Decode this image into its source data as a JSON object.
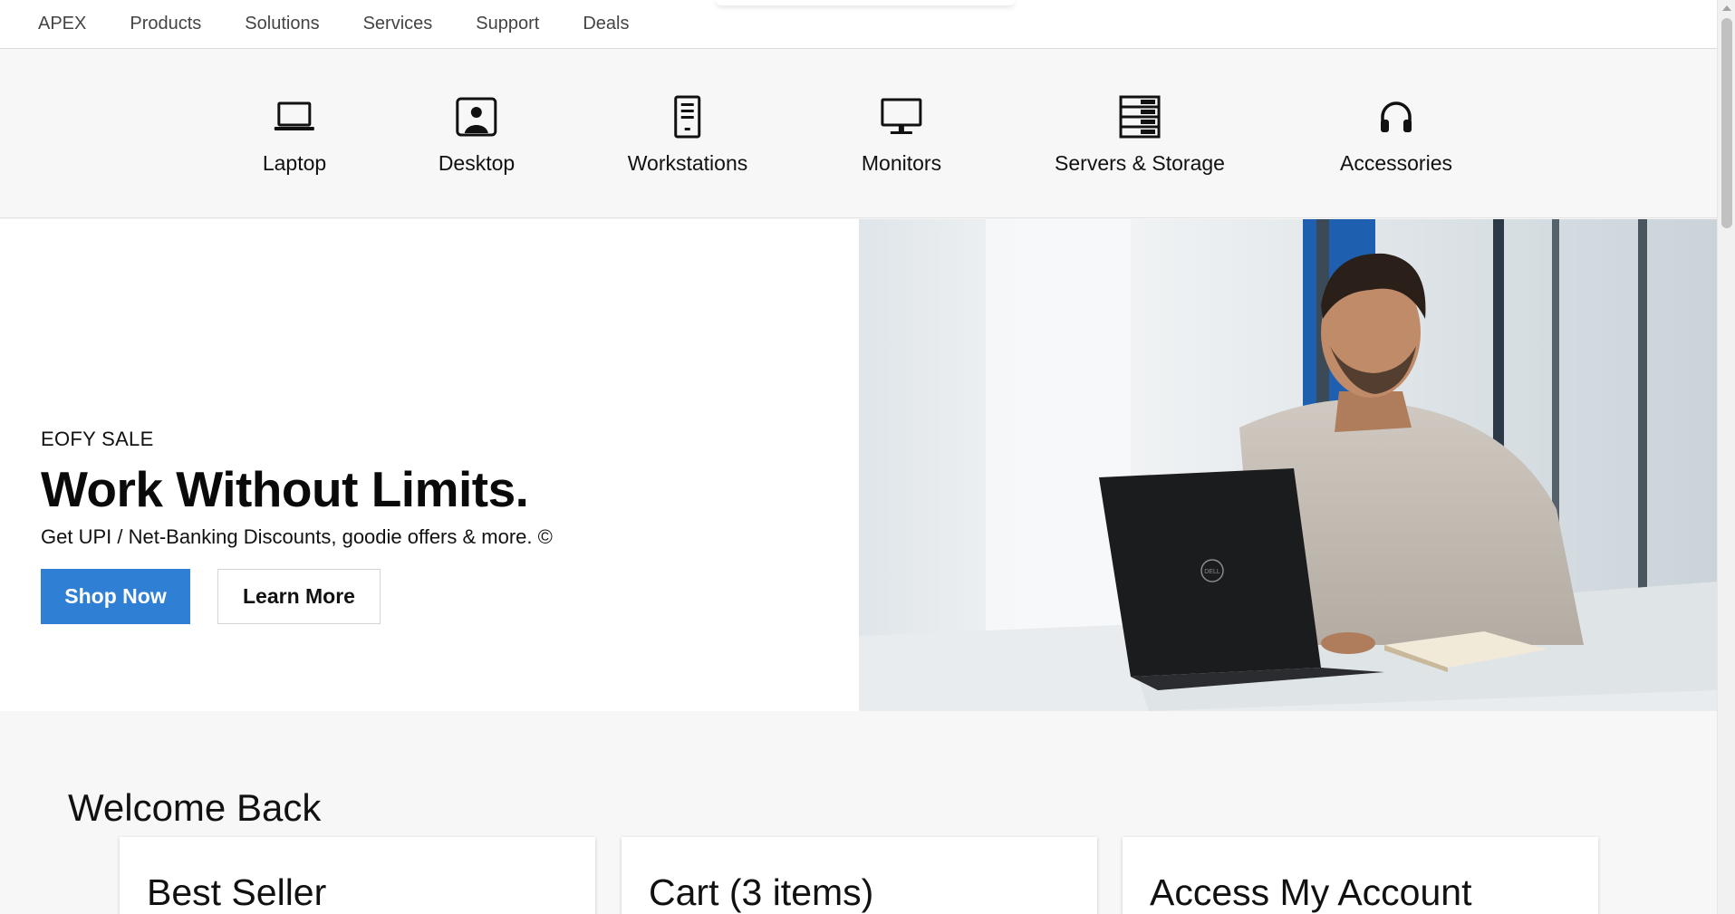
{
  "topnav": {
    "items": [
      "APEX",
      "Products",
      "Solutions",
      "Services",
      "Support",
      "Deals"
    ]
  },
  "categories": [
    {
      "label": "Laptop",
      "icon": "laptop-icon"
    },
    {
      "label": "Desktop",
      "icon": "desktop-icon"
    },
    {
      "label": "Workstations",
      "icon": "workstation-tower-icon"
    },
    {
      "label": "Monitors",
      "icon": "monitor-icon"
    },
    {
      "label": "Servers & Storage",
      "icon": "server-rack-icon"
    },
    {
      "label": "Accessories",
      "icon": "headphones-icon"
    }
  ],
  "hero": {
    "eyebrow": "EOFY SALE",
    "headline": "Work Without Limits.",
    "subline": "Get UPI / Net-Banking Discounts, goodie offers & more. ©",
    "primary_cta": "Shop Now",
    "secondary_cta": "Learn More",
    "laptop_logo": "DELL"
  },
  "welcome": {
    "title": "Welcome Back",
    "cards": [
      "Best Seller",
      "Cart (3 items)",
      "Access My Account"
    ]
  },
  "colors": {
    "accent": "#2f7fd4",
    "text": "#0e0e0e",
    "background": "#f7f7f7"
  }
}
